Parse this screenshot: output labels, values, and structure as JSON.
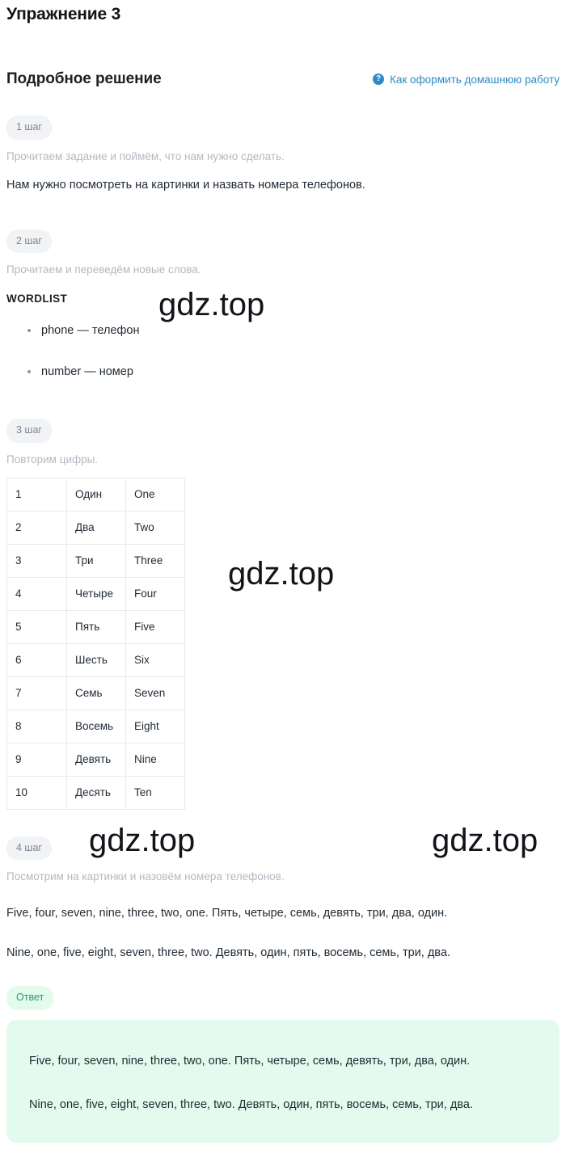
{
  "page": {
    "title": "Упражнение 3",
    "solution_heading": "Подробное решение",
    "help_link": "Как оформить домашнюю работу",
    "help_icon": "question-circle-icon"
  },
  "steps": [
    {
      "badge": "1 шаг",
      "hint": "Прочитаем задание и поймём, что нам нужно сделать.",
      "text": "Нам нужно посмотреть на картинки и назвать номера телефонов."
    },
    {
      "badge": "2 шаг",
      "hint": "Прочитаем и переведём новые слова.",
      "wordlist_title": "WORDLIST",
      "wordlist": [
        "phone — телефон",
        "number — номер"
      ]
    },
    {
      "badge": "3 шаг",
      "hint": "Повторим цифры."
    },
    {
      "badge": "4 шаг",
      "hint": "Посмотрим на картинки и назовём номера телефонов.",
      "lines": [
        "Five, four, seven, nine, three, two, one. Пять, четыре, семь, девять, три, два, один.",
        "Nine, one, five, eight, seven, three, two. Девять, один, пять, восемь, семь, три, два."
      ]
    }
  ],
  "numbers_table": {
    "rows": [
      {
        "digit": "1",
        "ru": "Один",
        "en": "One"
      },
      {
        "digit": "2",
        "ru": "Два",
        "en": "Two"
      },
      {
        "digit": "3",
        "ru": "Три",
        "en": "Three"
      },
      {
        "digit": "4",
        "ru": "Четыре",
        "en": "Four"
      },
      {
        "digit": "5",
        "ru": "Пять",
        "en": "Five"
      },
      {
        "digit": "6",
        "ru": "Шесть",
        "en": "Six"
      },
      {
        "digit": "7",
        "ru": "Семь",
        "en": "Seven"
      },
      {
        "digit": "8",
        "ru": "Восемь",
        "en": "Eight"
      },
      {
        "digit": "9",
        "ru": "Девять",
        "en": "Nine"
      },
      {
        "digit": "10",
        "ru": "Десять",
        "en": "Ten"
      }
    ]
  },
  "answer": {
    "badge": "Ответ",
    "lines": [
      "Five, four, seven, nine, three, two, one. Пять, четыре, семь, девять, три, два, один.",
      "Nine, one, five, eight, seven, three, two. Девять, один, пять, восемь, семь, три, два."
    ]
  },
  "watermarks": {
    "text": "gdz.top"
  },
  "colors": {
    "link": "#2b8cc4",
    "badge_bg": "#f2f3f5",
    "badge_text": "#7b8591",
    "answer_bg": "#e3fbee",
    "answer_badge_text": "#2e9a60",
    "hint_text": "#b3b9c0",
    "body_text": "#1f2933"
  }
}
